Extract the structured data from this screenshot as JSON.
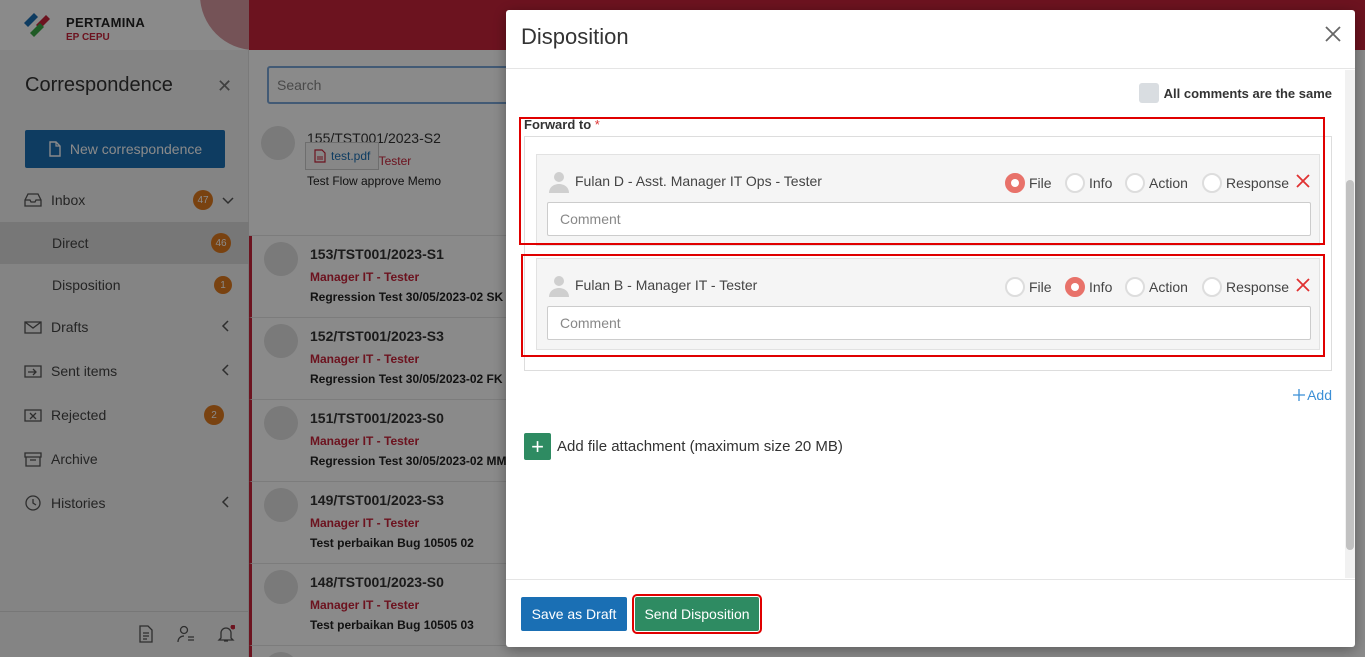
{
  "brand": {
    "name": "PERTAMINA",
    "sub": "EP CEPU",
    "colors": {
      "primary_red": "#c8233a",
      "blue": "#1a6fb4",
      "green": "#2e8b62",
      "badge": "#e07a1f"
    }
  },
  "sidebar": {
    "title": "Correspondence",
    "new_button": "New correspondence",
    "items": [
      {
        "label": "Inbox",
        "icon": "inbox-icon",
        "badge": "47",
        "chevron": "chevron-down-icon"
      },
      {
        "label": "Direct",
        "badge": "46"
      },
      {
        "label": "Disposition",
        "badge": "1"
      },
      {
        "label": "Drafts",
        "icon": "drafts-icon",
        "chevron": "chevron-left-icon"
      },
      {
        "label": "Sent items",
        "icon": "sent-icon",
        "chevron": "chevron-left-icon"
      },
      {
        "label": "Rejected",
        "icon": "rejected-icon",
        "badge": "2"
      },
      {
        "label": "Archive",
        "icon": "archive-icon"
      },
      {
        "label": "Histories",
        "icon": "history-icon",
        "chevron": "chevron-left-icon"
      }
    ]
  },
  "list": {
    "search_placeholder": "Search",
    "items": [
      {
        "number": "155/TST001/2023-S2",
        "role": "Manager IT - Tester",
        "subject": "Test Flow approve Memo",
        "attachment": "test.pdf"
      },
      {
        "number": "153/TST001/2023-S1",
        "role": "Manager IT - Tester",
        "subject": "Regression Test 30/05/2023-02 SK"
      },
      {
        "number": "152/TST001/2023-S3",
        "role": "Manager IT - Tester",
        "subject": "Regression Test 30/05/2023-02 FK"
      },
      {
        "number": "151/TST001/2023-S0",
        "role": "Manager IT - Tester",
        "subject": "Regression Test 30/05/2023-02 MM"
      },
      {
        "number": "149/TST001/2023-S3",
        "role": "Manager IT - Tester",
        "subject": "Test perbaikan Bug 10505 02"
      },
      {
        "number": "148/TST001/2023-S0",
        "role": "Manager IT - Tester",
        "subject": "Test perbaikan Bug 10505 03"
      }
    ]
  },
  "modal": {
    "title": "Disposition",
    "same_comments_label": "All comments are the same",
    "forward_label": "Forward to",
    "required_mark": "*",
    "options": [
      "File",
      "Info",
      "Action",
      "Response"
    ],
    "recipients": [
      {
        "name": "Fulan D - Asst. Manager IT Ops - Tester",
        "selected": "File",
        "comment_placeholder": "Comment"
      },
      {
        "name": "Fulan B - Manager IT - Tester",
        "selected": "Info",
        "comment_placeholder": "Comment"
      }
    ],
    "add_label": "Add",
    "add_file_label": "Add file attachment (maximum size 20 MB)",
    "save_draft": "Save as Draft",
    "send": "Send Disposition"
  }
}
